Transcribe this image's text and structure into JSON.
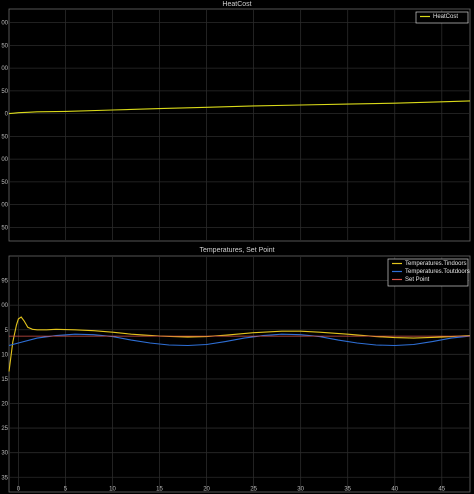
{
  "chart_data": [
    {
      "type": "line",
      "title": "HeatCost",
      "xlim": [
        -1,
        48
      ],
      "ylim": [
        -2.8,
        2.3
      ],
      "x_ticks": [
        5,
        10,
        15,
        20,
        25,
        30,
        35,
        40,
        45
      ],
      "y_ticks": [
        -2.5,
        -2,
        -1.5,
        -1,
        -0.5,
        0,
        0.5,
        1,
        1.5,
        2
      ],
      "y_tick_labels": [
        "50",
        "00",
        "50",
        "00",
        "50",
        "0",
        "50",
        "00",
        "50",
        "00"
      ],
      "grid": true,
      "legend_position": "top-right",
      "series": [
        {
          "name": "HeatCost",
          "color": "#d9d919",
          "x": [
            -1,
            -0.5,
            0,
            1,
            2,
            5,
            10,
            15,
            20,
            25,
            30,
            35,
            40,
            45,
            48
          ],
          "y": [
            0.0,
            0.01,
            0.02,
            0.03,
            0.04,
            0.05,
            0.08,
            0.11,
            0.14,
            0.17,
            0.19,
            0.21,
            0.23,
            0.26,
            0.28
          ]
        }
      ]
    },
    {
      "type": "line",
      "title": "Temperatures, Set Point",
      "xlim": [
        -1,
        48
      ],
      "ylim": [
        -3.3,
        1.5
      ],
      "x_ticks": [
        0,
        5,
        10,
        15,
        20,
        25,
        30,
        35,
        40,
        45
      ],
      "x_tick_labels": [
        "0",
        "5",
        "10",
        "15",
        "20",
        "25",
        "30",
        "35",
        "40",
        "45"
      ],
      "y_ticks": [
        -3,
        -2.5,
        -2,
        -1.5,
        -1,
        -0.5,
        0,
        0.5,
        1
      ],
      "y_tick_labels": [
        "35",
        "30",
        "25",
        "20",
        "15",
        "10",
        "5",
        "00",
        "95"
      ],
      "grid": true,
      "legend_position": "top-right",
      "series": [
        {
          "name": "Temperatures.Tindoors",
          "color": "#e3c41c",
          "x": [
            -1,
            -0.6,
            -0.2,
            0,
            0.3,
            0.6,
            1,
            1.5,
            2,
            3,
            4,
            6,
            8,
            10,
            12,
            15,
            18,
            20,
            22,
            25,
            28,
            30,
            32,
            35,
            38,
            40,
            42,
            45,
            48
          ],
          "y": [
            -0.85,
            -0.25,
            0.1,
            0.22,
            0.26,
            0.18,
            0.05,
            0.01,
            0.0,
            0.0,
            0.01,
            0.0,
            -0.02,
            -0.05,
            -0.09,
            -0.13,
            -0.15,
            -0.14,
            -0.11,
            -0.06,
            -0.03,
            -0.03,
            -0.05,
            -0.09,
            -0.14,
            -0.16,
            -0.17,
            -0.15,
            -0.12
          ]
        },
        {
          "name": "Temperatures.Toutdoors",
          "color": "#2e6fd6",
          "x": [
            -1,
            0,
            2,
            4,
            6,
            8,
            10,
            12,
            14,
            16,
            18,
            20,
            22,
            24,
            26,
            28,
            30,
            32,
            34,
            36,
            38,
            40,
            42,
            44,
            46,
            48
          ],
          "y": [
            -0.32,
            -0.27,
            -0.17,
            -0.12,
            -0.09,
            -0.1,
            -0.14,
            -0.21,
            -0.27,
            -0.31,
            -0.32,
            -0.3,
            -0.24,
            -0.17,
            -0.12,
            -0.09,
            -0.1,
            -0.14,
            -0.21,
            -0.27,
            -0.31,
            -0.32,
            -0.3,
            -0.24,
            -0.17,
            -0.13
          ]
        },
        {
          "name": "Set Point",
          "color": "#d9534a",
          "x": [
            -1,
            48
          ],
          "y": [
            -0.13,
            -0.13
          ]
        }
      ]
    }
  ]
}
